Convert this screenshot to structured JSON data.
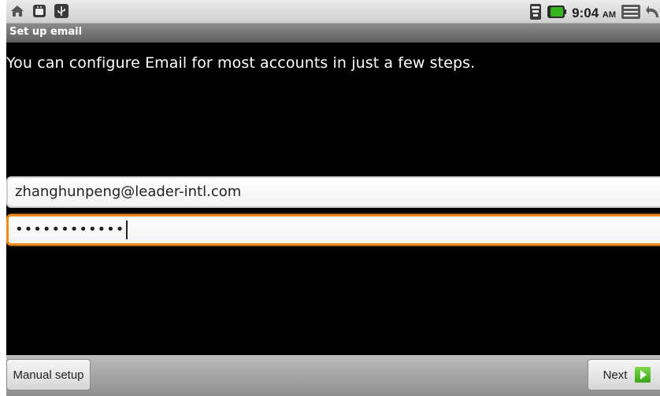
{
  "status_bar": {
    "time": "9:04",
    "ampm": "AM",
    "icons": [
      "home-icon",
      "android-icon",
      "usb-icon",
      "signal-icon",
      "battery-icon",
      "menu-icon",
      "back-icon"
    ]
  },
  "title_bar": {
    "title": "Set up email"
  },
  "main": {
    "instructions": "You can configure Email for most accounts in just a few steps.",
    "email": {
      "value": "zhanghunpeng@leader-intl.com"
    },
    "password": {
      "masked_value": "••••••••••••"
    }
  },
  "bottom_bar": {
    "manual_setup_label": "Manual setup",
    "next_label": "Next"
  },
  "colors": {
    "focus": "#f08a1c",
    "next_arrow": "#3aa41a"
  }
}
